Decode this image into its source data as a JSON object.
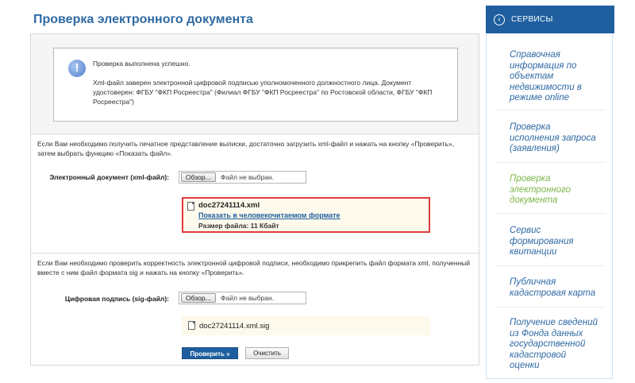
{
  "page_title": "Проверка электронного документа",
  "notice": {
    "line1": "Проверка выполнена успешно.",
    "line2": "Xml-файл заверен электронной цифровой подписью уполномоченного должностного лица. Документ удостоверен: ФГБУ \"ФКП Росреестра\" (Филиал ФГБУ \"ФКП Росреестра\" по Ростовской области, ФГБУ \"ФКП Росреестра\")"
  },
  "section1": {
    "instructions": "Если Вам необходимо получить печатное представление выписки, достаточно загрузить xml-файл и нажать на кнопку «Проверить», затем выбрать функцию «Показать файл».",
    "field_label": "Электронный документ (xml-файл):",
    "browse_label": "Обзор...",
    "file_status": "Файл не выбран.",
    "result": {
      "file_name": "doc27241114.xml",
      "show_link": "Показать в человекочитаемом формате",
      "file_size": "Размер файла: 11 Кбайт"
    }
  },
  "section2": {
    "instructions": "Если Вам необходимо проверить корректность электронной цифровой подписи, необходимо прикрепить файл формата xml, полученный вместе с ним файл формата sig и нажать на кнопку «Проверить».",
    "field_label": "Цифровая подпись (sig-файл):",
    "browse_label": "Обзор...",
    "file_status": "Файл не выбран.",
    "sig_file_name": "doc27241114.xml.sig",
    "check_button": "Проверить »",
    "clear_button": "Очистить"
  },
  "sidebar": {
    "title": "СЕРВИСЫ",
    "items": [
      {
        "line1": "Справочная",
        "line2": "информация по",
        "line3": "объектам",
        "line4": "недвижимости в",
        "line5": "режиме online"
      },
      {
        "line1": "Проверка",
        "line2": "исполнения запроса",
        "line3": "(заявления)"
      },
      {
        "line1": "Проверка",
        "line2": "электронного",
        "line3": "документа"
      },
      {
        "line1": "Сервис",
        "line2": "формирования",
        "line3": "квитанции"
      },
      {
        "line1": "Публичная",
        "line2": "кадастровая карта"
      },
      {
        "line1": "Получение сведений",
        "line2": "из Фонда данных",
        "line3": "государственной",
        "line4": "кадастровой",
        "line5": "оценки"
      }
    ],
    "active_index": 2
  },
  "colors": {
    "accent": "#1f5f9f",
    "title": "#2f6aa3",
    "active_link": "#7cb649",
    "highlight_border": "#e03a3a"
  }
}
